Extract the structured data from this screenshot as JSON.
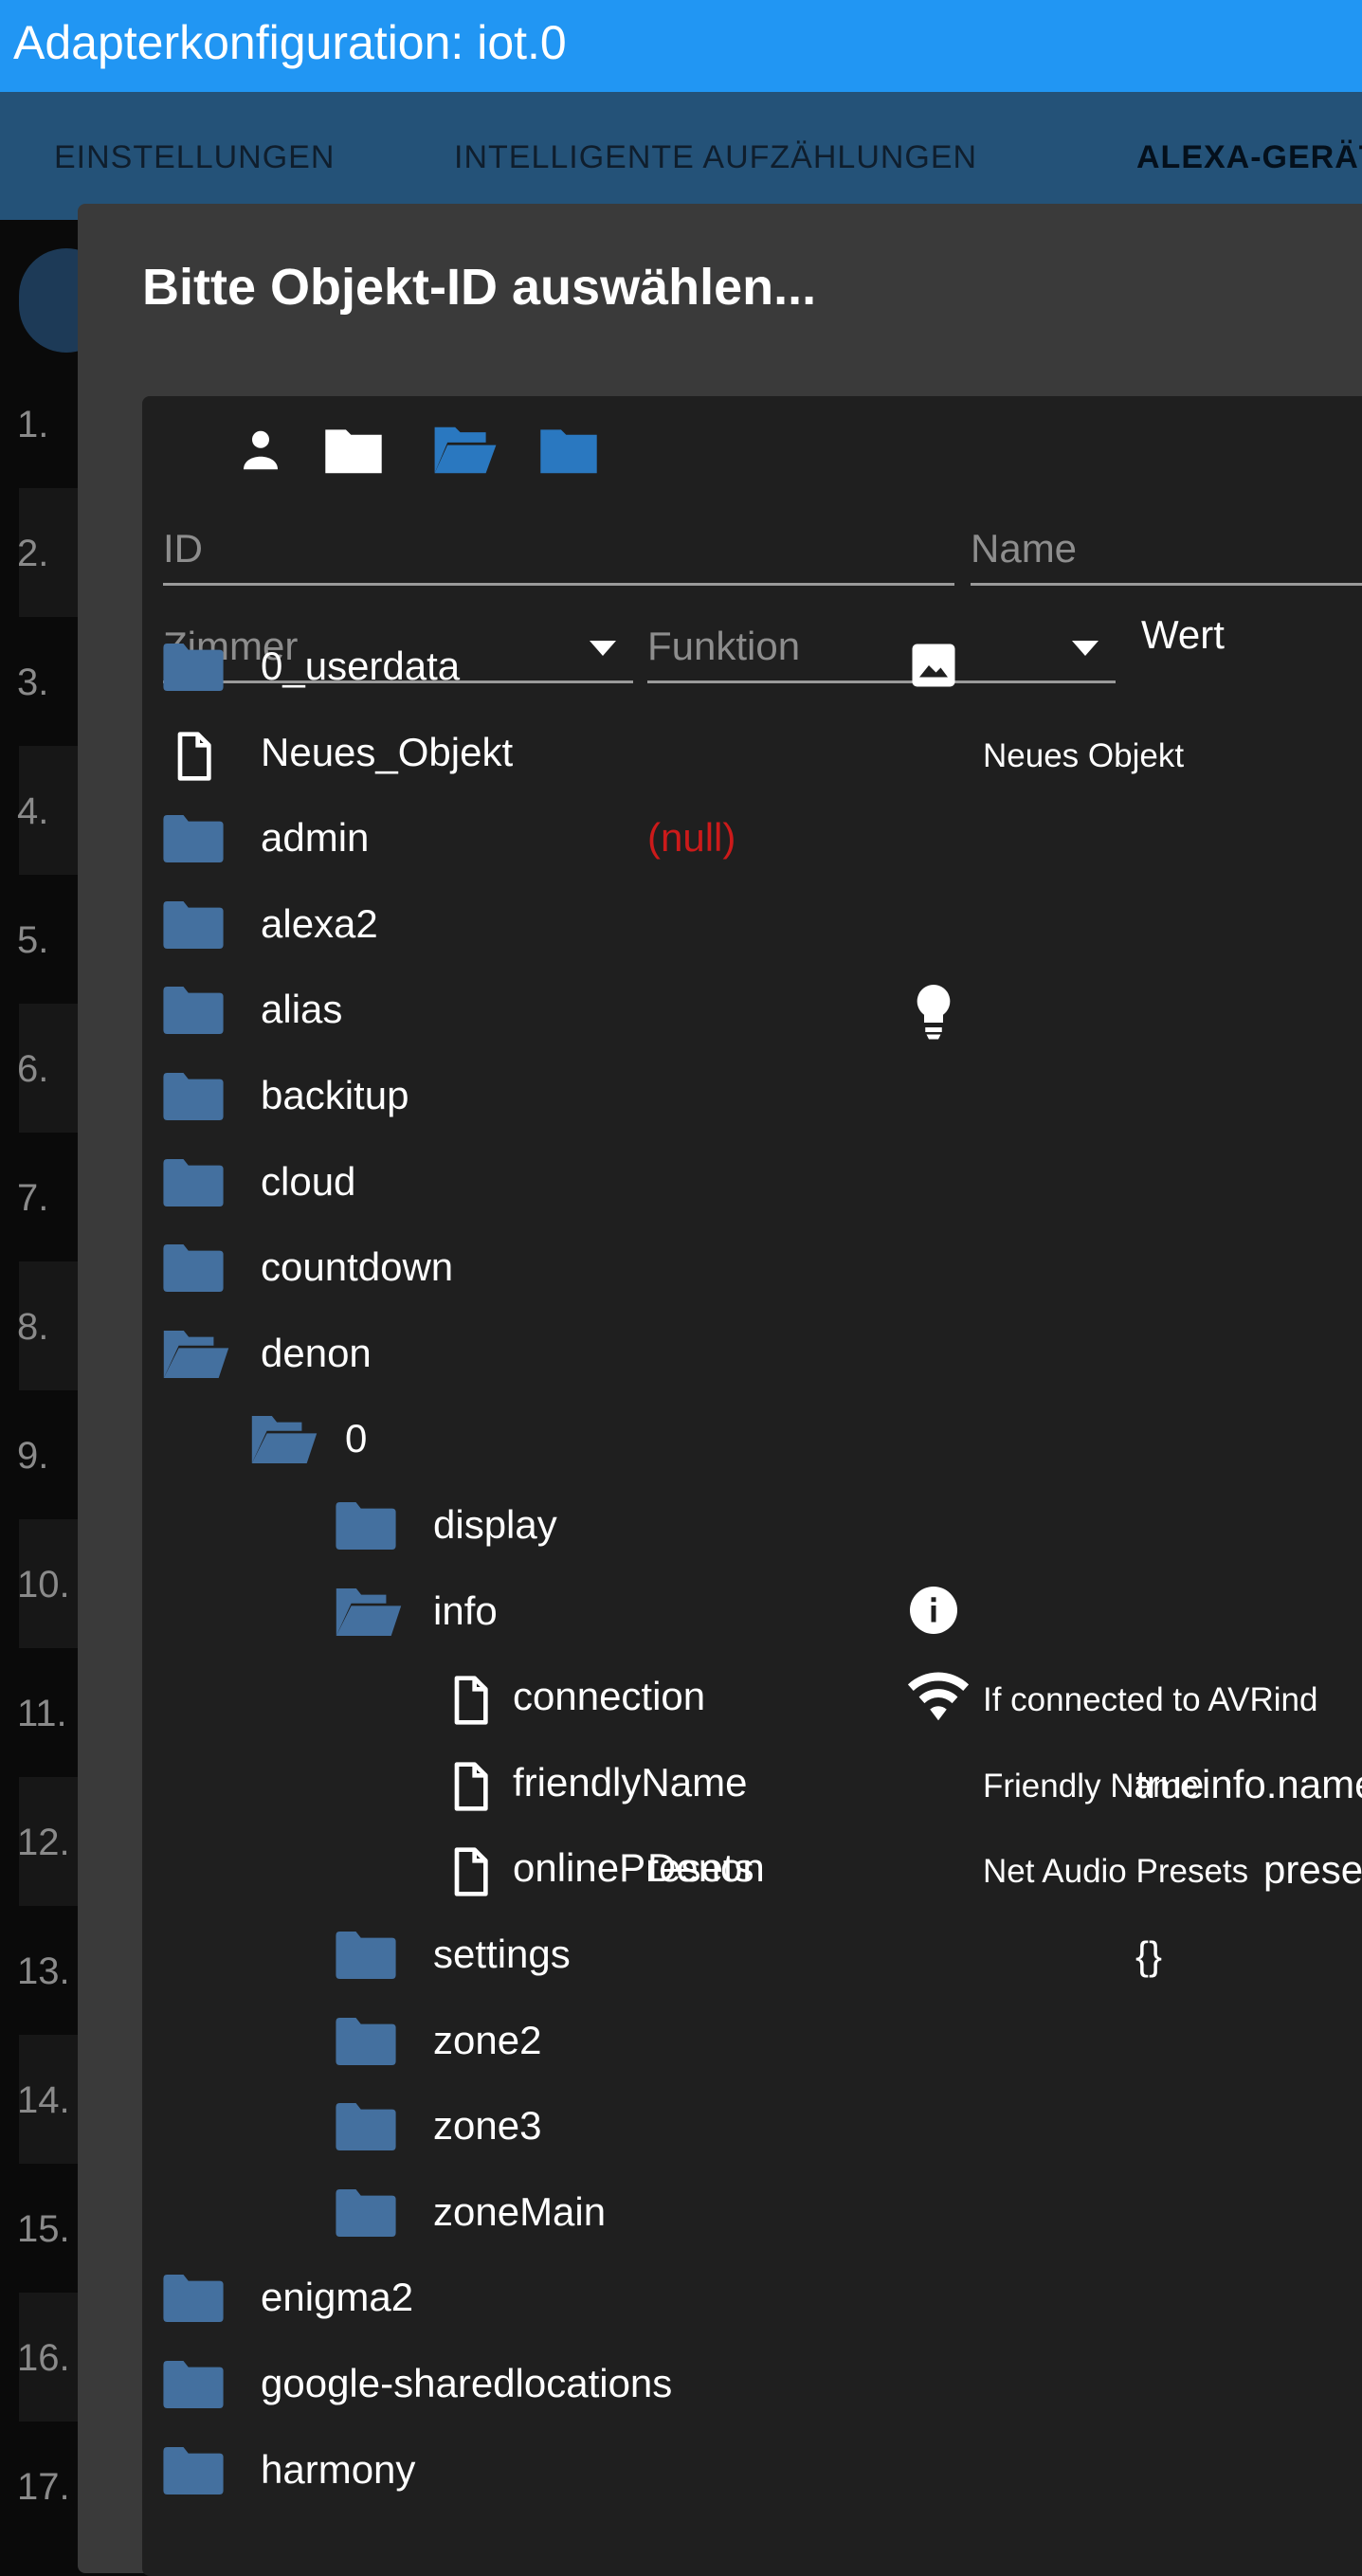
{
  "app": {
    "title": "Adapterkonfiguration: iot.0"
  },
  "tabs": [
    {
      "label": "EINSTELLUNGEN",
      "active": false
    },
    {
      "label": "INTELLIGENTE AUFZÄHLUNGEN",
      "active": false
    },
    {
      "label": "ALEXA-GERÄTE",
      "active": true
    }
  ],
  "line_numbers": [
    "1.",
    "2.",
    "3.",
    "4.",
    "5.",
    "6.",
    "7.",
    "8.",
    "9.",
    "10.",
    "11.",
    "12.",
    "13.",
    "14.",
    "15.",
    "16.",
    "17."
  ],
  "dialog": {
    "title": "Bitte Objekt-ID auswählen...",
    "toolbar_icons": [
      "person-icon",
      "folder-icon",
      "folder-open-icon",
      "folder-icon"
    ],
    "filters": {
      "id_placeholder": "ID",
      "name_placeholder": "Name",
      "room_placeholder": "Zimmer",
      "function_placeholder": "Funktion",
      "value_header": "Wert"
    },
    "tree": [
      {
        "name": "0_userdata",
        "level": 0,
        "icon": "folder",
        "row_icon": "image-icon"
      },
      {
        "name": "Neues_Objekt",
        "level": 0,
        "icon": "file",
        "desc": "Neues Objekt"
      },
      {
        "name": "admin",
        "level": 0,
        "icon": "folder",
        "extra": "(null)",
        "extra_color": "#cc1a1a"
      },
      {
        "name": "alexa2",
        "level": 0,
        "icon": "folder"
      },
      {
        "name": "alias",
        "level": 0,
        "icon": "folder",
        "row_icon": "lightbulb-icon"
      },
      {
        "name": "backitup",
        "level": 0,
        "icon": "folder"
      },
      {
        "name": "cloud",
        "level": 0,
        "icon": "folder"
      },
      {
        "name": "countdown",
        "level": 0,
        "icon": "folder"
      },
      {
        "name": "denon",
        "level": 0,
        "icon": "folder-open"
      },
      {
        "name": "0",
        "level": 1,
        "icon": "folder-open"
      },
      {
        "name": "display",
        "level": 2,
        "icon": "folder"
      },
      {
        "name": "info",
        "level": 2,
        "icon": "folder-open",
        "row_icon": "info-icon"
      },
      {
        "name": "connection",
        "level": 3,
        "icon": "file",
        "row_icon": "wifi-icon",
        "desc": "If connected to AVRind"
      },
      {
        "name": "friendlyName",
        "level": 3,
        "icon": "file",
        "desc": "Friendly Name",
        "value": "true",
        "value2": "info.name"
      },
      {
        "name": "onlinePresets",
        "level": 3,
        "icon": "file",
        "extra": "Denon",
        "extra_color": "#ffffff",
        "desc": "Net Audio Presets",
        "value2": "presets"
      },
      {
        "name": "settings",
        "level": 2,
        "icon": "folder",
        "value": "{}"
      },
      {
        "name": "zone2",
        "level": 2,
        "icon": "folder"
      },
      {
        "name": "zone3",
        "level": 2,
        "icon": "folder"
      },
      {
        "name": "zoneMain",
        "level": 2,
        "icon": "folder"
      },
      {
        "name": "enigma2",
        "level": 0,
        "icon": "folder"
      },
      {
        "name": "google-sharedlocations",
        "level": 0,
        "icon": "folder"
      },
      {
        "name": "harmony",
        "level": 0,
        "icon": "folder"
      }
    ]
  },
  "colors": {
    "titlebar": "#2196f3",
    "tabbar": "#245278",
    "folder": "#44709f",
    "toolbar_folder": "#2a78c0",
    "null": "#cc1a1a"
  }
}
